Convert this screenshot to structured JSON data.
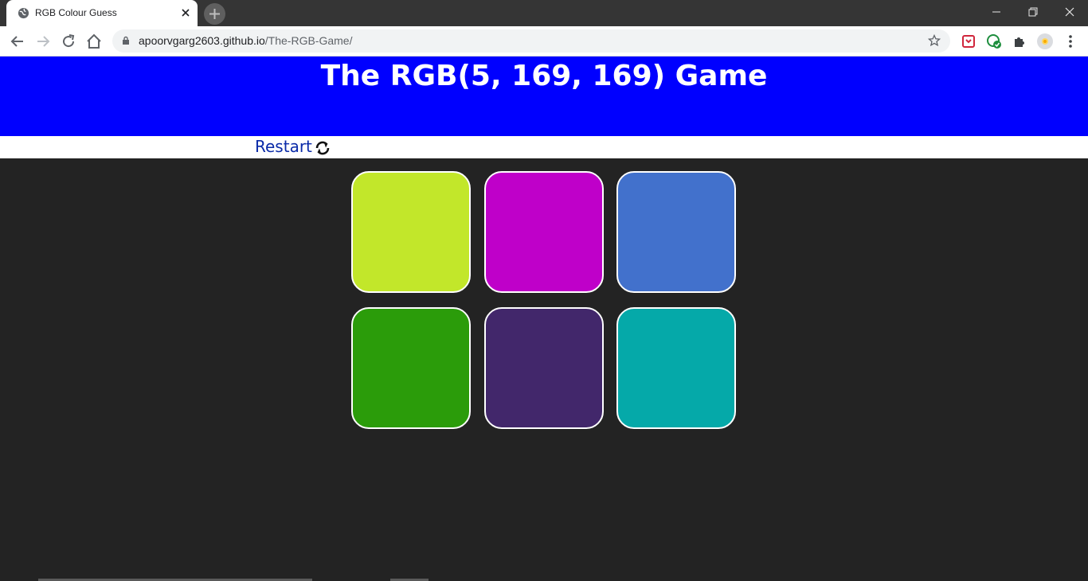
{
  "browser": {
    "tab_title": "RGB Colour Guess",
    "url_host": "apoorvgarg2603.github.io",
    "url_path": "/The-RGB-Game/"
  },
  "game": {
    "title": "The RGB(5, 169, 169) Game",
    "restart_label": "Restart",
    "header_color": "#0000ff",
    "squares": [
      {
        "color": "#c2e72a"
      },
      {
        "color": "#bf00c9"
      },
      {
        "color": "#4271cc"
      },
      {
        "color": "#2b9c0a"
      },
      {
        "color": "#42276b"
      },
      {
        "color": "#05a9a9"
      }
    ]
  }
}
